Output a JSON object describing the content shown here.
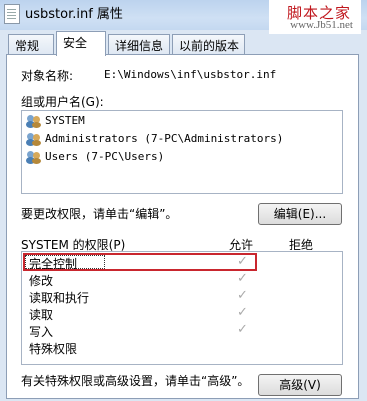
{
  "window": {
    "title": "usbstor.inf 属性"
  },
  "watermark": {
    "line1": "脚本之家",
    "line2": "www.Jb51.net"
  },
  "tabs": [
    {
      "label": "常规"
    },
    {
      "label": "安全"
    },
    {
      "label": "详细信息"
    },
    {
      "label": "以前的版本"
    }
  ],
  "object": {
    "label": "对象名称:",
    "value": "E:\\Windows\\inf\\usbstor.inf"
  },
  "groups": {
    "label": "组或用户名(G):",
    "items": [
      {
        "name": "SYSTEM"
      },
      {
        "name": "Administrators (7-PC\\Administrators)"
      },
      {
        "name": "Users (7-PC\\Users)"
      }
    ]
  },
  "edit": {
    "hint": "要更改权限，请单击“编辑”。",
    "button": "编辑(E)..."
  },
  "permissions": {
    "label": "SYSTEM 的权限(P)",
    "allow_header": "允许",
    "deny_header": "拒绝",
    "rows": [
      {
        "name": "完全控制",
        "allow": "✓"
      },
      {
        "name": "修改",
        "allow": "✓"
      },
      {
        "name": "读取和执行",
        "allow": "✓"
      },
      {
        "name": "读取",
        "allow": "✓"
      },
      {
        "name": "写入",
        "allow": "✓"
      },
      {
        "name": "特殊权限",
        "allow": ""
      }
    ]
  },
  "advanced": {
    "hint": "有关特殊权限或高级设置，请单击“高级”。",
    "button": "高级(V)"
  },
  "colors": {
    "highlight": "#c9262e",
    "watermark": "#c0171d"
  }
}
